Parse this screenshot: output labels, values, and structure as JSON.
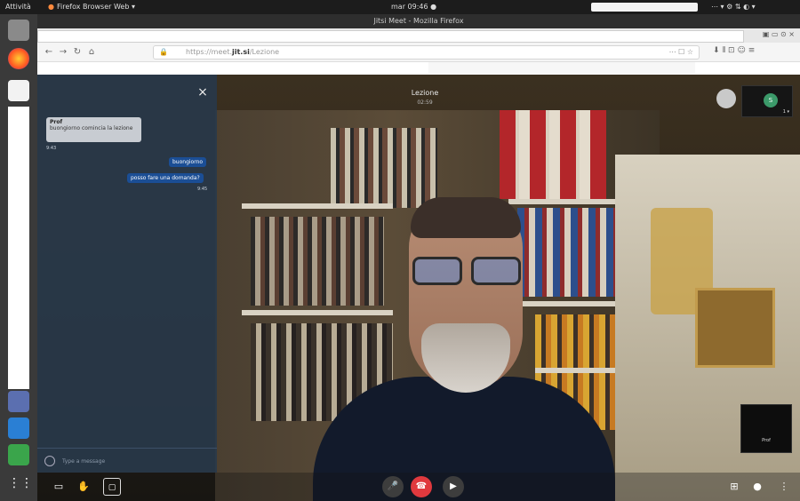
{
  "os": {
    "activities": "Attività",
    "app_menu": "Firefox Browser Web ▾",
    "clock": "mar 09:46 ●"
  },
  "window": {
    "title": "Jitsi Meet - Mozilla Firefox"
  },
  "browser": {
    "url_prefix": "https://meet.",
    "url_domain": "jit.si",
    "url_path": "/Lezione"
  },
  "meeting": {
    "name": "Lezione",
    "elapsed": "02:59"
  },
  "chat": {
    "close": "×",
    "incoming": {
      "sender": "Prof",
      "text": "buongiorno comincia la lezione",
      "time": "9:43"
    },
    "outgoing": [
      {
        "text": "buongiorno"
      },
      {
        "text": "posso fare una domanda?",
        "time": "9:45"
      }
    ],
    "input_placeholder": "Type a message"
  },
  "participants": {
    "remote_initial": "S",
    "remote_indicator": "1 ▾",
    "local_name": "Prof"
  },
  "colors": {
    "hangup": "#e0393e",
    "accent": "#1b4e95",
    "avatar": "#3c9a6a"
  }
}
